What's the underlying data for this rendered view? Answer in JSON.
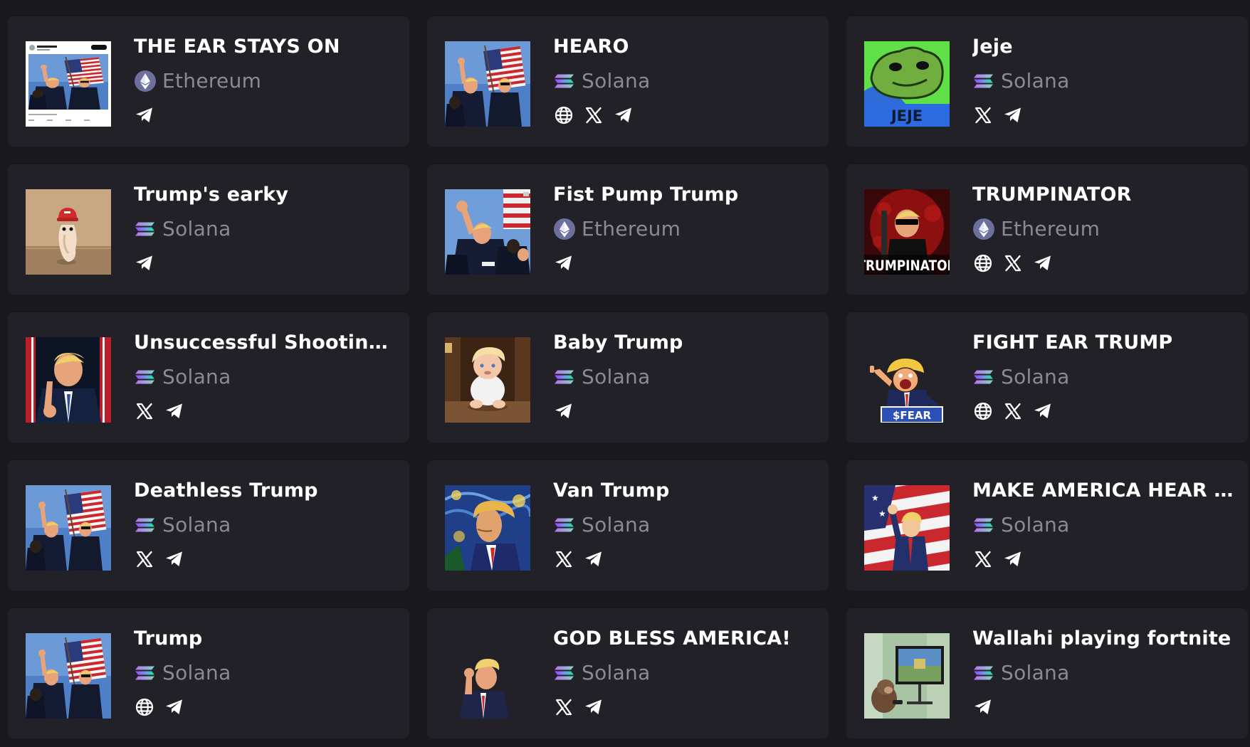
{
  "colors": {
    "background": "#18181d",
    "card": "#212127",
    "title": "#ffffff",
    "chain_text": "#8a8a92",
    "ethereum_circle": "#6d6f9c",
    "solana_gradient": [
      "#9945ff",
      "#14f195"
    ]
  },
  "tokens": [
    {
      "title": "THE EAR STAYS ON",
      "chain": "Ethereum",
      "chain_icon": "ethereum-icon",
      "thumb": "tweet-screenshot",
      "socials": [
        "telegram"
      ]
    },
    {
      "title": "HEARO",
      "chain": "Solana",
      "chain_icon": "solana-icon",
      "thumb": "rally-flag",
      "socials": [
        "website",
        "x",
        "telegram"
      ]
    },
    {
      "title": "Jeje",
      "chain": "Solana",
      "chain_icon": "solana-icon",
      "thumb": "jeje-frog",
      "thumb_text": "JEJE",
      "socials": [
        "x",
        "telegram"
      ]
    },
    {
      "title": "Trump's earky",
      "chain": "Solana",
      "chain_icon": "solana-icon",
      "thumb": "ear-figure",
      "socials": [
        "telegram"
      ]
    },
    {
      "title": "Fist Pump Trump",
      "chain": "Ethereum",
      "chain_icon": "ethereum-icon",
      "thumb": "fist-pump",
      "socials": [
        "telegram"
      ]
    },
    {
      "title": "TRUMPINATOR",
      "chain": "Ethereum",
      "chain_icon": "ethereum-icon",
      "thumb": "trumpinator",
      "thumb_text": "TRUMPINATOR",
      "socials": [
        "website",
        "x",
        "telegram"
      ]
    },
    {
      "title": "Unsuccessful Shooting ...",
      "chain": "Solana",
      "chain_icon": "solana-icon",
      "thumb": "portrait-point",
      "socials": [
        "x",
        "telegram"
      ]
    },
    {
      "title": "Baby Trump",
      "chain": "Solana",
      "chain_icon": "solana-icon",
      "thumb": "baby",
      "socials": [
        "telegram"
      ]
    },
    {
      "title": "FIGHT EAR TRUMP",
      "chain": "Solana",
      "chain_icon": "solana-icon",
      "thumb": "cartoon-fight",
      "thumb_text": "$FEAR",
      "socials": [
        "website",
        "x",
        "telegram"
      ]
    },
    {
      "title": "Deathless Trump",
      "chain": "Solana",
      "chain_icon": "solana-icon",
      "thumb": "rally-flag",
      "socials": [
        "x",
        "telegram"
      ]
    },
    {
      "title": "Van Trump",
      "chain": "Solana",
      "chain_icon": "solana-icon",
      "thumb": "starry-portrait",
      "socials": [
        "x",
        "telegram"
      ]
    },
    {
      "title": "MAKE AMERICA HEAR AG...",
      "chain": "Solana",
      "chain_icon": "solana-icon",
      "thumb": "cartoon-flag",
      "socials": [
        "x",
        "telegram"
      ]
    },
    {
      "title": "Trump",
      "chain": "Solana",
      "chain_icon": "solana-icon",
      "thumb": "rally-flag",
      "socials": [
        "website",
        "telegram"
      ]
    },
    {
      "title": "GOD BLESS AMERICA!",
      "chain": "Solana",
      "chain_icon": "solana-icon",
      "thumb": "cutout-fist",
      "socials": [
        "x",
        "telegram"
      ]
    },
    {
      "title": "Wallahi playing fortnite",
      "chain": "Solana",
      "chain_icon": "solana-icon",
      "thumb": "monkey-tv",
      "socials": [
        "telegram"
      ]
    }
  ]
}
